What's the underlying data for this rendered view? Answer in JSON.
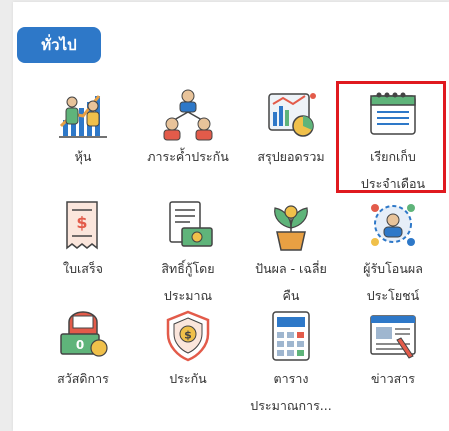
{
  "tab": {
    "label": "ทั่วไป"
  },
  "colors": {
    "accent": "#2e78c8",
    "highlight": "#e0191f"
  },
  "items": [
    {
      "name": "stocks",
      "lines": [
        "หุ้น",
        ""
      ],
      "icon": "stock-investor-icon"
    },
    {
      "name": "guarantee-fee",
      "lines": [
        "ภาระค้ำประกัน",
        ""
      ],
      "icon": "guarantee-people-icon"
    },
    {
      "name": "balance-summary",
      "lines": [
        "สรุปยอดรวม",
        ""
      ],
      "icon": "dashboard-chart-icon"
    },
    {
      "name": "monthly-collection",
      "lines": [
        "เรียกเก็บ",
        "ประจำเดือน"
      ],
      "icon": "calendar-icon"
    },
    {
      "name": "receipt",
      "lines": [
        "ใบเสร็จ",
        ""
      ],
      "icon": "receipt-icon"
    },
    {
      "name": "estimated-loan-rights",
      "lines": [
        "สิทธิ์กู้โดย",
        "ประมาณ"
      ],
      "icon": "loan-rights-icon"
    },
    {
      "name": "dividend-average-return",
      "lines": [
        "ปันผล - เฉลี่ย",
        "คืน"
      ],
      "icon": "dividend-plant-icon"
    },
    {
      "name": "beneficiary",
      "lines": [
        "ผู้รับโอนผล",
        "ประโยชน์"
      ],
      "icon": "beneficiary-icon"
    },
    {
      "name": "welfare",
      "lines": [
        "สวัสดิการ",
        ""
      ],
      "icon": "welfare-money-icon"
    },
    {
      "name": "insurance",
      "lines": [
        "ประกัน",
        ""
      ],
      "icon": "insurance-shield-icon"
    },
    {
      "name": "estimate-table",
      "lines": [
        "ตาราง",
        "ประมาณการ..."
      ],
      "icon": "calculator-icon"
    },
    {
      "name": "news",
      "lines": [
        "ข่าวสาร",
        ""
      ],
      "icon": "news-icon"
    }
  ]
}
